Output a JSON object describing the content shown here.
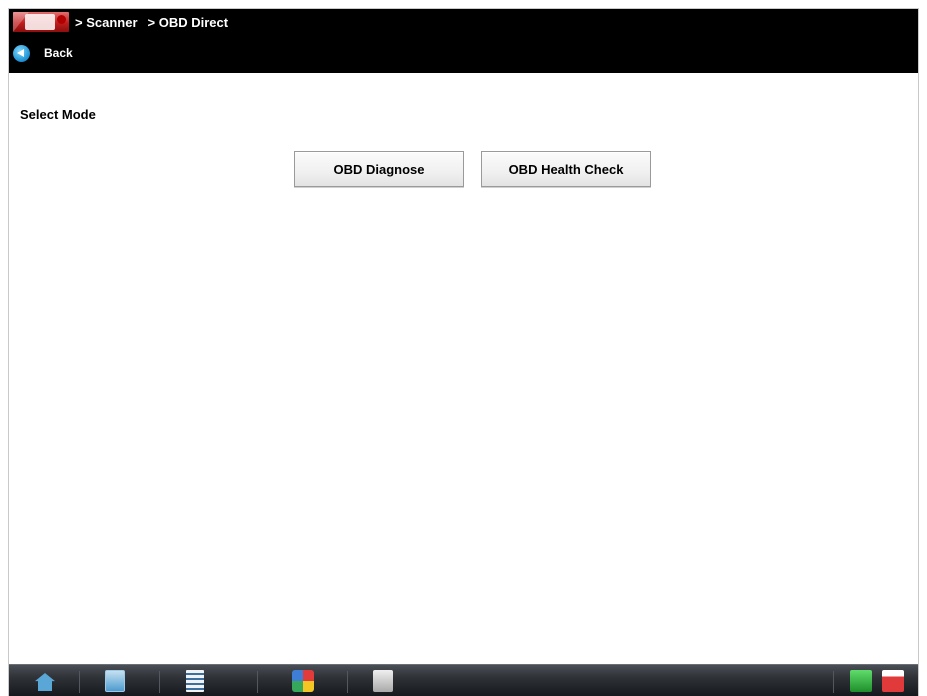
{
  "header": {
    "breadcrumbs": [
      "> Scanner",
      "> OBD Direct"
    ],
    "back_label": "Back"
  },
  "main": {
    "section_label": "Select Mode",
    "buttons": [
      {
        "label": "OBD Diagnose"
      },
      {
        "label": "OBD Health Check"
      }
    ]
  },
  "taskbar": {
    "icons": [
      "home-icon",
      "scanner-icon",
      "data-list-icon",
      "tools-icon",
      "print-icon",
      "connection-status-icon",
      "battery-status-icon"
    ]
  },
  "colors": {
    "header_bg": "#000000",
    "header_text": "#ffffff",
    "logo_red": "#c11d1d",
    "back_icon_blue": "#1b8fd1",
    "button_bg": "#f0f0f0",
    "taskbar_bg": "#2f3338"
  }
}
